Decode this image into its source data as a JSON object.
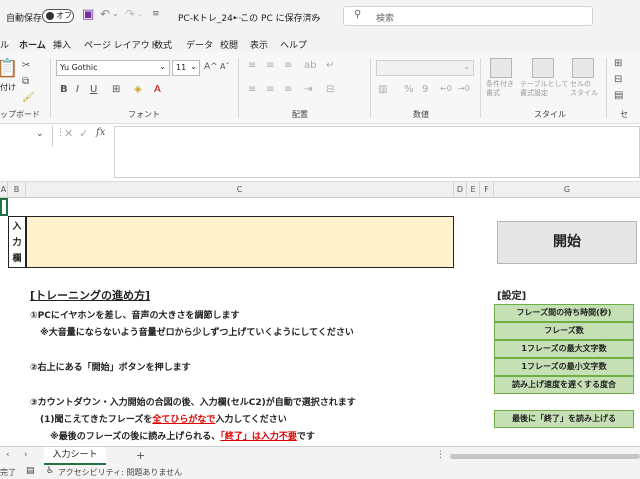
{
  "titlebar": {
    "autosave_label": "自動保存",
    "autosave_state": "オフ",
    "file_name": "PC-Kトレ_24···",
    "save_location": "• この PC に保存済み",
    "search_placeholder": "検索"
  },
  "menu": {
    "items": [
      "ル",
      "ホーム",
      "挿入",
      "ページ レイアウト",
      "数式",
      "データ",
      "校閲",
      "表示",
      "ヘルプ"
    ],
    "active": "ホーム"
  },
  "ribbon": {
    "paste_label": "付け",
    "clipboard_label": "ップボード",
    "font_name": "Yu Gothic",
    "font_size": "11",
    "font_group_label": "フォント",
    "align_group_label": "配置",
    "number_group_label": "数値",
    "style_group_label": "スタイル",
    "cell_group_label": "セ",
    "cond_format_label": "条件付き\n書式",
    "table_format_label": "テーブルとして\n書式設定",
    "cell_style_label": "セルの\nスタイル",
    "percent_symbol": "%",
    "comma_symbol": "9"
  },
  "formula_bar": {
    "fx_label": "fx"
  },
  "columns": [
    "A",
    "B",
    "C",
    "D",
    "E",
    "F",
    "G"
  ],
  "sheet": {
    "input_label_chars": [
      "入",
      "力",
      "欄"
    ],
    "start_button": "開始",
    "heading": "[トレーニングの進め方]",
    "step1": "①PCにイヤホンを差し、音声の大きさを調節します",
    "step1_note": "※大音量にならないよう音量ゼロから少しずつ上げていくようにしてください",
    "step2": "②右上にある「開始」ボタンを押します",
    "step3": "③カウントダウン・入力開始の合図の後、入力欄(セルC2)が自動で選択されます",
    "step3_1_pre": "(1)聞こえてきたフレーズを",
    "step3_1_red": "全てひらがなで",
    "step3_1_post": "入力してください",
    "step3_note_pre": "※最後のフレーズの後に読み上げられる、",
    "step3_note_red": "「終了」は入力不要",
    "step3_note_post": "です",
    "settings_heading": "[設定]",
    "settings": [
      "フレーズ間の待ち時間(秒)",
      "フレーズ数",
      "1フレーズの最大文字数",
      "1フレーズの最小文字数",
      "読み上げ速度を遅くする度合"
    ],
    "final_setting": "最後に「終了」を読み上げる"
  },
  "tabs": {
    "active_sheet": "入力シート",
    "add_symbol": "+"
  },
  "status": {
    "ready": "完了",
    "accessibility": "アクセシビリティ: 問題ありません"
  }
}
